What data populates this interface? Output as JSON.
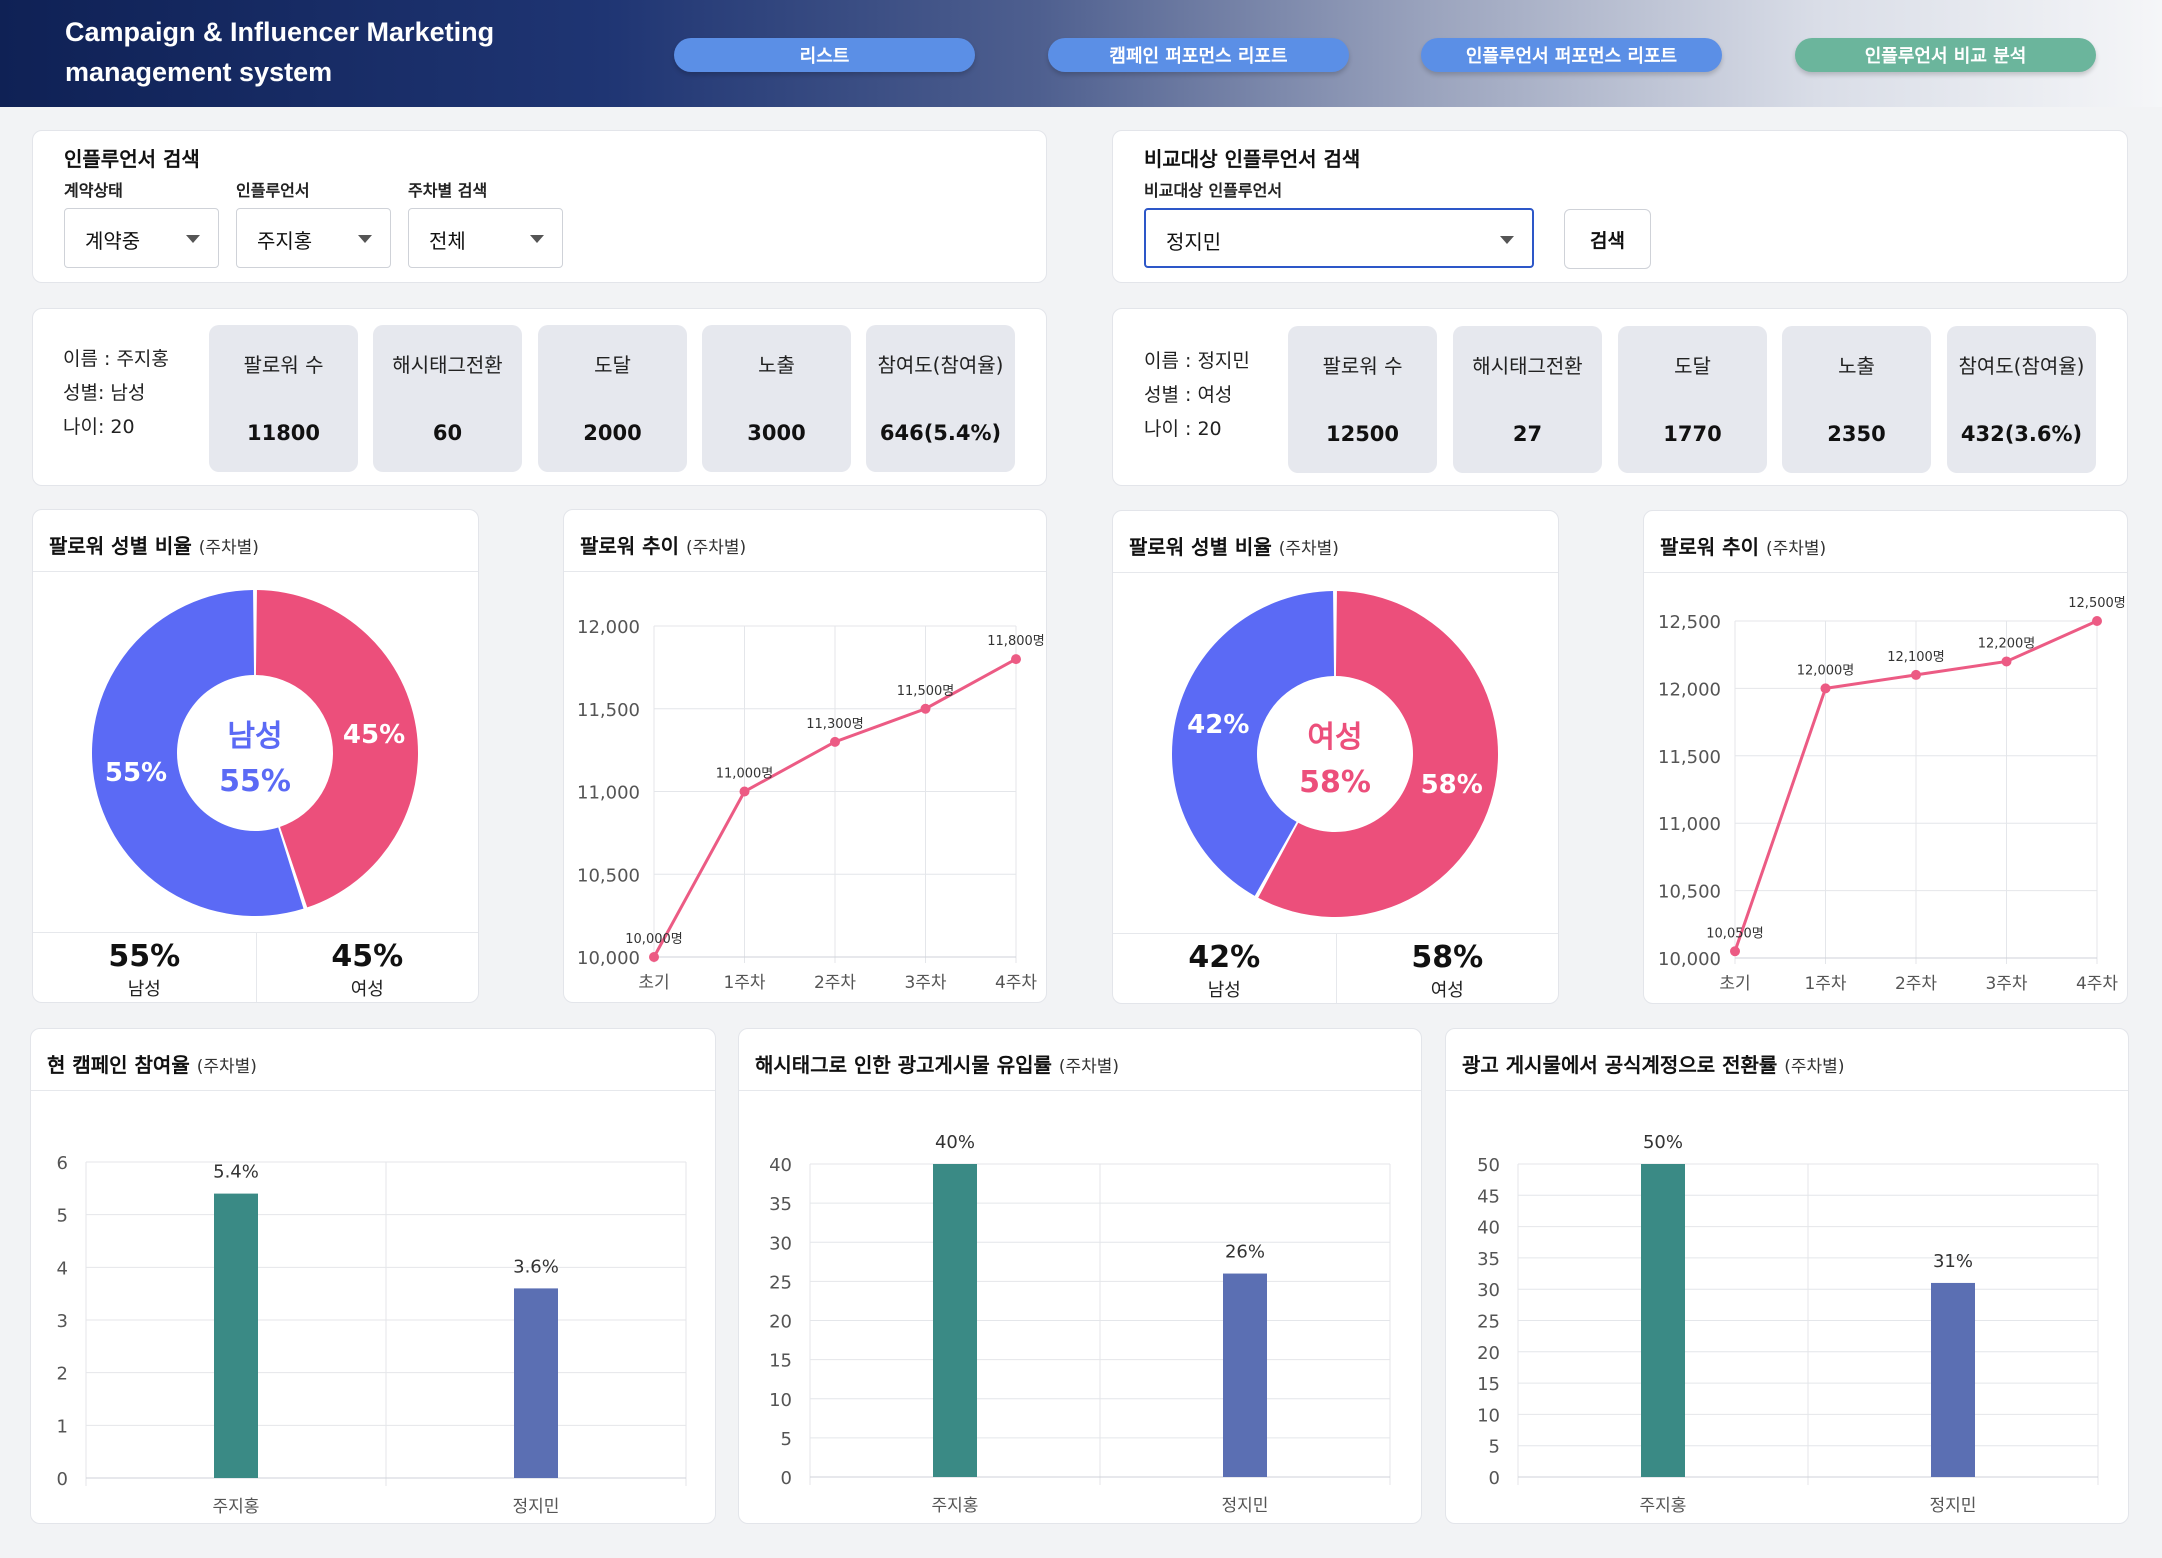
{
  "app": {
    "title": "Campaign & Influencer Marketing management system"
  },
  "nav": [
    {
      "label": "리스트",
      "color": "#5b8fe6"
    },
    {
      "label": "캠페인 퍼포먼스 리포트",
      "color": "#5b8fe6"
    },
    {
      "label": "인플루언서 퍼포먼스 리포트",
      "color": "#5b8fe6"
    },
    {
      "label": "인플루언서 비교 분석",
      "color": "#6bb59c"
    }
  ],
  "search": {
    "title": "인플루언서 검색",
    "contract_label": "계약상태",
    "contract_value": "계약중",
    "influencer_label": "인플루언서",
    "influencer_value": "주지홍",
    "week_label": "주차별 검색",
    "week_value": "전체"
  },
  "compare_search": {
    "title": "비교대상 인플루언서 검색",
    "label": "비교대상 인플루언서",
    "value": "정지민",
    "button": "검색"
  },
  "profiles": [
    {
      "name_line": "이름 : 주지홍",
      "gender_line": "성별: 남성",
      "age_line": "나이: 20",
      "stats": [
        {
          "label": "팔로워 수",
          "value": "11800"
        },
        {
          "label": "해시태그전환",
          "value": "60"
        },
        {
          "label": "도달",
          "value": "2000"
        },
        {
          "label": "노출",
          "value": "3000"
        },
        {
          "label": "참여도(참여율)",
          "value": "646(5.4%)"
        }
      ]
    },
    {
      "name_line": "이름 : 정지민",
      "gender_line": "성별 : 여성",
      "age_line": "나이 : 20",
      "stats": [
        {
          "label": "팔로워 수",
          "value": "12500"
        },
        {
          "label": "해시태그전환",
          "value": "27"
        },
        {
          "label": "도달",
          "value": "1770"
        },
        {
          "label": "노출",
          "value": "2350"
        },
        {
          "label": "참여도(참여율)",
          "value": "432(3.6%)"
        }
      ]
    }
  ],
  "gender_panels": [
    {
      "title": "팔로워 성별 비율",
      "sub": "(주차별)",
      "center_label": "남성",
      "center_value": "55%",
      "center_color": "#5b6af5",
      "male_pct": 55,
      "female_pct": 45,
      "male_label": "55%",
      "female_label": "45%",
      "male_text": "남성",
      "female_text": "여성"
    },
    {
      "title": "팔로워 성별 비율",
      "sub": "(주차별)",
      "center_label": "여성",
      "center_value": "58%",
      "center_color": "#ec4f7b",
      "male_pct": 42,
      "female_pct": 58,
      "male_label": "42%",
      "female_label": "58%",
      "male_text": "남성",
      "female_text": "여성"
    }
  ],
  "colors": {
    "male": "#5b6af5",
    "female": "#ec4f7b",
    "teal": "#3a8a85",
    "slate": "#5b6fb3",
    "line": "#ec5b84"
  },
  "chart_data": [
    {
      "type": "line",
      "title": "팔로워 추이",
      "subtitle": "(주차별)",
      "categories": [
        "초기",
        "1주차",
        "2주차",
        "3주차",
        "4주차"
      ],
      "values": [
        10000,
        11000,
        11300,
        11500,
        11800
      ],
      "point_labels": [
        "10,000명",
        "11,000명",
        "11,300명",
        "11,500명",
        "11,800명"
      ],
      "ylim": [
        10000,
        12000
      ],
      "yticks": [
        "10,000",
        "10,500",
        "11,000",
        "11,500",
        "12,000"
      ],
      "ytick_values": [
        10000,
        10500,
        11000,
        11500,
        12000
      ],
      "grid": true
    },
    {
      "type": "line",
      "title": "팔로워 추이",
      "subtitle": "(주차별)",
      "categories": [
        "초기",
        "1주차",
        "2주차",
        "3주차",
        "4주차"
      ],
      "values": [
        10050,
        12000,
        12100,
        12200,
        12500
      ],
      "point_labels": [
        "10,050명",
        "12,000명",
        "12,100명",
        "12,200명",
        "12,500명"
      ],
      "ylim": [
        10000,
        12500
      ],
      "yticks": [
        "10,000",
        "10,500",
        "11,000",
        "11,500",
        "12,000",
        "12,500"
      ],
      "ytick_values": [
        10000,
        10500,
        11000,
        11500,
        12000,
        12500
      ],
      "grid": true
    },
    {
      "type": "bar",
      "title": "현 캠페인 참여율",
      "subtitle": "(주차별)",
      "categories": [
        "주지홍",
        "정지민"
      ],
      "values": [
        5.4,
        3.6
      ],
      "value_labels": [
        "5.4%",
        "3.6%"
      ],
      "ylim": [
        0,
        6
      ],
      "yticks": [
        "0",
        "1",
        "2",
        "3",
        "4",
        "5",
        "6"
      ],
      "ytick_values": [
        0,
        1,
        2,
        3,
        4,
        5,
        6
      ],
      "grid": true
    },
    {
      "type": "bar",
      "title": "해시태그로 인한 광고게시물 유입률",
      "subtitle": "(주차별)",
      "categories": [
        "주지홍",
        "정지민"
      ],
      "values": [
        40,
        26
      ],
      "value_labels": [
        "40%",
        "26%"
      ],
      "ylim": [
        0,
        40
      ],
      "yticks": [
        "0",
        "5",
        "10",
        "15",
        "20",
        "25",
        "30",
        "35",
        "40"
      ],
      "ytick_values": [
        0,
        5,
        10,
        15,
        20,
        25,
        30,
        35,
        40
      ],
      "grid": true
    },
    {
      "type": "bar",
      "title": "광고 게시물에서 공식계정으로 전환률",
      "subtitle": "(주차별)",
      "categories": [
        "주지홍",
        "정지민"
      ],
      "values": [
        50,
        31
      ],
      "value_labels": [
        "50%",
        "31%"
      ],
      "ylim": [
        0,
        50
      ],
      "yticks": [
        "0",
        "5",
        "10",
        "15",
        "20",
        "25",
        "30",
        "35",
        "40",
        "45",
        "50"
      ],
      "ytick_values": [
        0,
        5,
        10,
        15,
        20,
        25,
        30,
        35,
        40,
        45,
        50
      ],
      "grid": true
    }
  ]
}
